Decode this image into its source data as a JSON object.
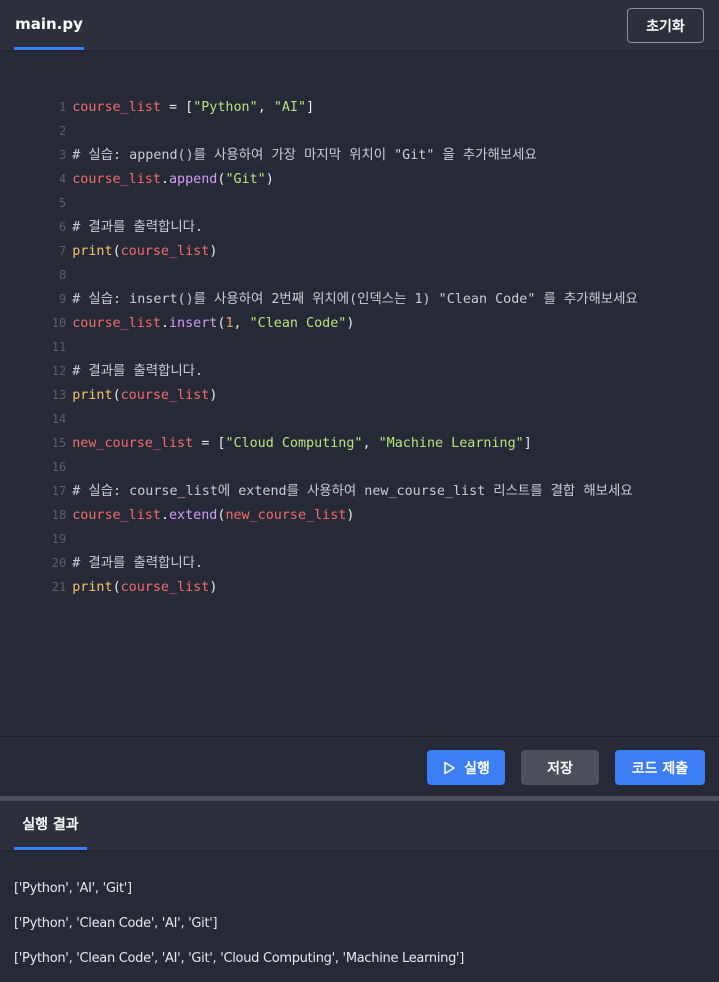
{
  "header": {
    "file_tab": "main.py",
    "reset_label": "초기화"
  },
  "editor": {
    "lines": [
      {
        "n": "1"
      },
      {
        "n": "2"
      },
      {
        "n": "3"
      },
      {
        "n": "4"
      },
      {
        "n": "5"
      },
      {
        "n": "6"
      },
      {
        "n": "7"
      },
      {
        "n": "8"
      },
      {
        "n": "9"
      },
      {
        "n": "10"
      },
      {
        "n": "11"
      },
      {
        "n": "12"
      },
      {
        "n": "13"
      },
      {
        "n": "14"
      },
      {
        "n": "15"
      },
      {
        "n": "16"
      },
      {
        "n": "17"
      },
      {
        "n": "18"
      },
      {
        "n": "19"
      },
      {
        "n": "20"
      },
      {
        "n": "21"
      }
    ],
    "code": {
      "l1": [
        "course_list",
        " = [",
        "\"Python\"",
        ", ",
        "\"AI\"",
        "]"
      ],
      "l3": "# 실습: append()를 사용하여 가장 마지막 위치이 \"Git\" 을 추가해보세요",
      "l4": [
        "course_list",
        ".",
        "append",
        "(",
        "\"Git\"",
        ")"
      ],
      "l6": "# 결과를 출력합니다.",
      "l7": [
        "print",
        "(",
        "course_list",
        ")"
      ],
      "l9": "# 실습: insert()를 사용하여 2번째 위치에(인덱스는 1) \"Clean Code\" 를 추가해보세요",
      "l10": [
        "course_list",
        ".",
        "insert",
        "(",
        "1",
        ", ",
        "\"Clean Code\"",
        ")"
      ],
      "l12": "# 결과를 출력합니다.",
      "l13": [
        "print",
        "(",
        "course_list",
        ")"
      ],
      "l15": [
        "new_course_list",
        " = [",
        "\"Cloud Computing\"",
        ", ",
        "\"Machine Learning\"",
        "]"
      ],
      "l17": "# 실습: course_list에 extend를 사용하여 new_course_list 리스트를 결합 해보세요",
      "l18": [
        "course_list",
        ".",
        "extend",
        "(",
        "new_course_list",
        ")"
      ],
      "l20": "# 결과를 출력합니다.",
      "l21": [
        "print",
        "(",
        "course_list",
        ")"
      ]
    }
  },
  "toolbar": {
    "run_label": "실행",
    "save_label": "저장",
    "submit_label": "코드 제출",
    "run_icon": "play-icon"
  },
  "result": {
    "tab_label": "실행 결과",
    "lines": [
      "['Python', 'AI', 'Git']",
      "['Python', 'Clean Code', 'AI', 'Git']",
      "['Python', 'Clean Code', 'AI', 'Git', 'Cloud Computing', 'Machine Learning']"
    ]
  },
  "colors": {
    "accent": "#3d7df4",
    "background": "#262a36",
    "variable": "#f16b6b",
    "string": "#b7e37e",
    "method": "#d29ef2",
    "builtin": "#f4c46a",
    "number": "#f29b5a"
  }
}
